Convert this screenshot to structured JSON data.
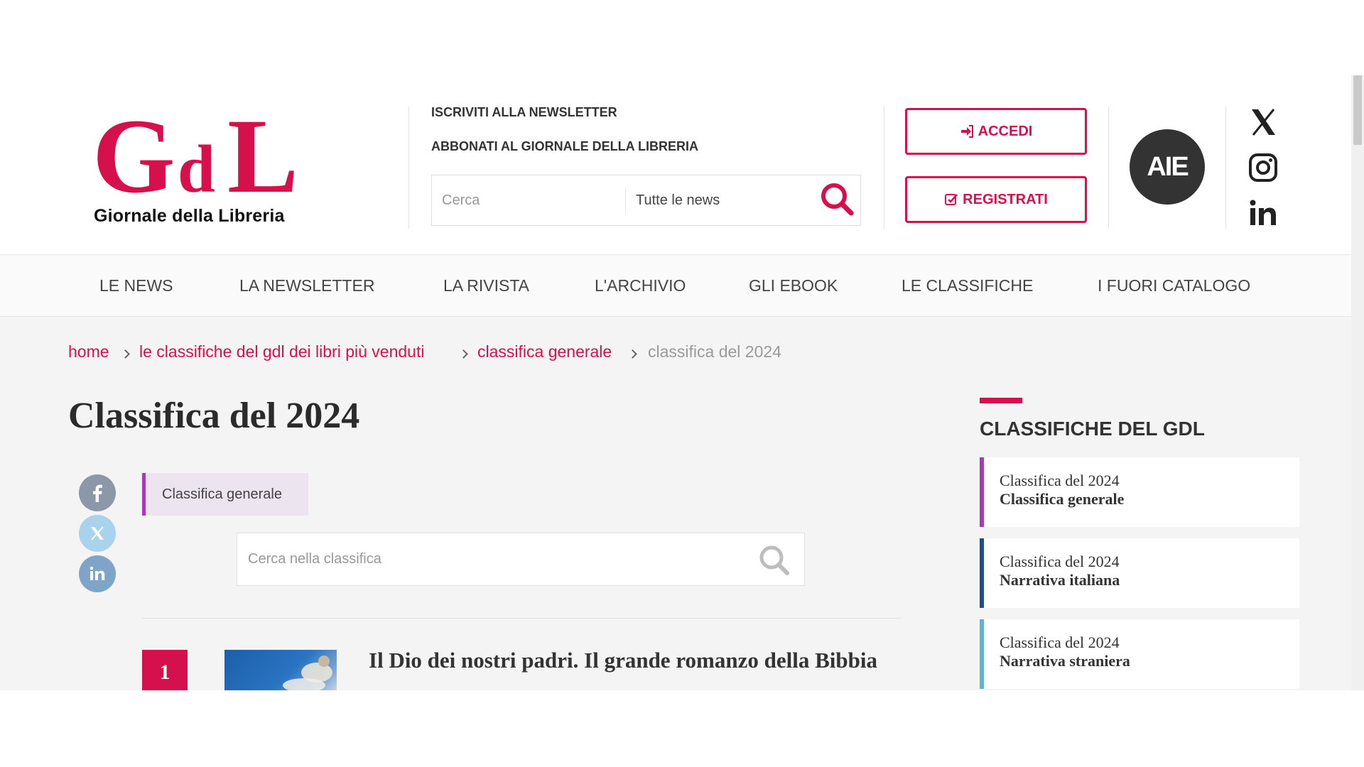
{
  "header": {
    "logo_text": "GdL",
    "logo_subtitle": "Giornale della Libreria",
    "newsletter_link": "ISCRIVITI ALLA NEWSLETTER",
    "subscribe_link": "ABBONATI AL GIORNALE DELLA LIBRERIA",
    "search_placeholder": "Cerca",
    "search_scope": "Tutte le news",
    "login_label": "ACCEDI",
    "register_label": "REGISTRATI",
    "aie_logo": "AIE",
    "social": [
      "x-icon",
      "instagram-icon",
      "linkedin-icon"
    ]
  },
  "nav": {
    "items": [
      "LE NEWS",
      "LA NEWSLETTER",
      "LA RIVISTA",
      "L'ARCHIVIO",
      "GLI EBOOK",
      "LE CLASSIFICHE",
      "I FUORI CATALOGO"
    ]
  },
  "breadcrumb": [
    "home",
    "le classifiche del gdl dei libri più venduti",
    "classifica generale",
    "classifica del 2024"
  ],
  "main": {
    "title": "Classifica del 2024",
    "category_tag": "Classifica generale",
    "search_placeholder": "Cerca nella classifica",
    "entries": [
      {
        "rank": "1",
        "title": "Il Dio dei nostri padri. Il grande romanzo della Bibbia"
      }
    ]
  },
  "sidebar": {
    "title": "CLASSIFICHE DEL GDL",
    "cards": [
      {
        "line1": "Classifica del 2024",
        "line2": "Classifica generale",
        "accent": "#a63ab8"
      },
      {
        "line1": "Classifica del 2024",
        "line2": "Narrativa italiana",
        "accent": "#1f4e8c"
      },
      {
        "line1": "Classifica del 2024",
        "line2": "Narrativa straniera",
        "accent": "#5bb6d0"
      }
    ]
  },
  "colors": {
    "brand": "#d6104d",
    "text": "#333333",
    "facebook": "#8c97a8",
    "twitter": "#a9d3ec",
    "linkedin": "#7ea5c8"
  }
}
